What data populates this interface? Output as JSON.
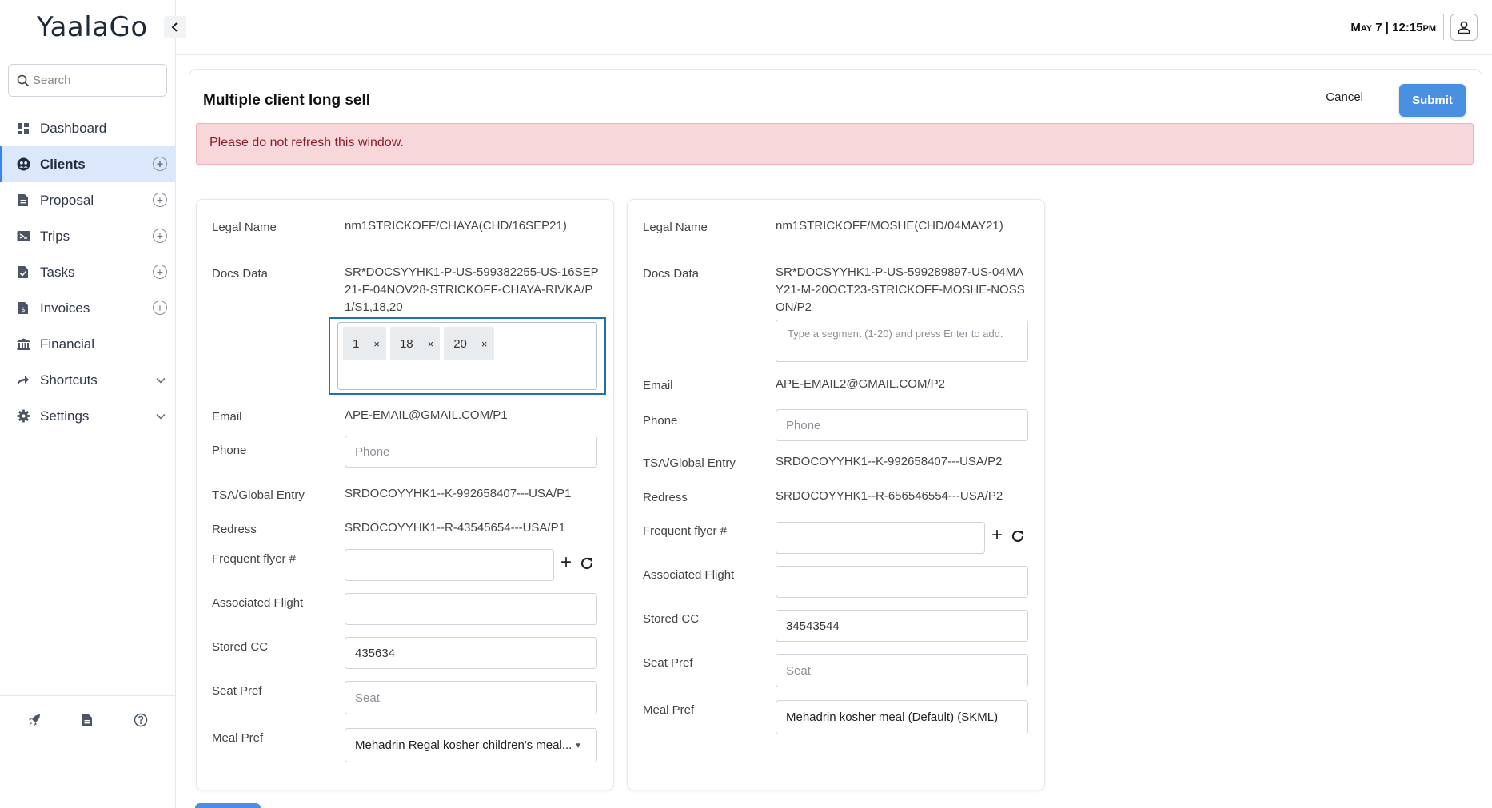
{
  "app": {
    "brand": "YaalaGo"
  },
  "sidebar": {
    "search_placeholder": "Search",
    "items": [
      {
        "label": "Dashboard",
        "icon": "dashboard-icon"
      },
      {
        "label": "Clients",
        "icon": "clients-icon",
        "active": true
      },
      {
        "label": "Proposal",
        "icon": "proposal-icon"
      },
      {
        "label": "Trips",
        "icon": "trips-icon"
      },
      {
        "label": "Tasks",
        "icon": "tasks-icon"
      },
      {
        "label": "Invoices",
        "icon": "invoices-icon"
      },
      {
        "label": "Financial",
        "icon": "financial-icon"
      },
      {
        "label": "Shortcuts",
        "icon": "shortcuts-icon"
      },
      {
        "label": "Settings",
        "icon": "settings-icon"
      }
    ]
  },
  "topbar": {
    "datetime": "May 7 | 12:15pm"
  },
  "panel": {
    "title": "Multiple client long sell",
    "cancel_label": "Cancel",
    "submit_label": "Submit",
    "alert": "Please do not refresh this window."
  },
  "labels": {
    "legal_name": "Legal Name",
    "docs_data": "Docs Data",
    "email": "Email",
    "phone": "Phone",
    "tsa": "TSA/Global Entry",
    "redress": "Redress",
    "ff": "Frequent flyer #",
    "assoc_flight": "Associated Flight",
    "stored_cc": "Stored CC",
    "seat_pref": "Seat Pref",
    "meal_pref": "Meal Pref"
  },
  "placeholders": {
    "phone": "Phone",
    "seat": "Seat",
    "segment": "Type a segment (1-20) and press Enter to add."
  },
  "client1": {
    "legal_name": "nm1STRICKOFF/CHAYA(CHD/16SEP21)",
    "docs_line1": "SR*DOCSYYHK1-P-US-599382255-US-16SEP",
    "docs_line2": "21-F-04NOV28-STRICKOFF-CHAYA-RIVKA/P",
    "docs_line3": "1/S1,18,20",
    "segments": [
      "1",
      "18",
      "20"
    ],
    "email": "APE-EMAIL@GMAIL.COM/P1",
    "tsa": "SRDOCOYYHK1--K-992658407---USA/P1",
    "redress": "SRDOCOYYHK1--R-43545654---USA/P1",
    "stored_cc": "435634",
    "meal_pref": "Mehadrin Regal kosher children's meal..."
  },
  "client2": {
    "legal_name": "nm1STRICKOFF/MOSHE(CHD/04MAY21)",
    "docs_line1": "SR*DOCSYYHK1-P-US-599289897-US-04MA",
    "docs_line2": "Y21-M-20OCT23-STRICKOFF-MOSHE-NOSS",
    "docs_line3": "ON/P2",
    "email": "APE-EMAIL2@GMAIL.COM/P2",
    "tsa": "SRDOCOYYHK1--K-992658407---USA/P2",
    "redress": "SRDOCOYYHK1--R-656546554---USA/P2",
    "stored_cc": "34543544",
    "meal_pref": "Mehadrin kosher meal (Default) (SKML)"
  }
}
